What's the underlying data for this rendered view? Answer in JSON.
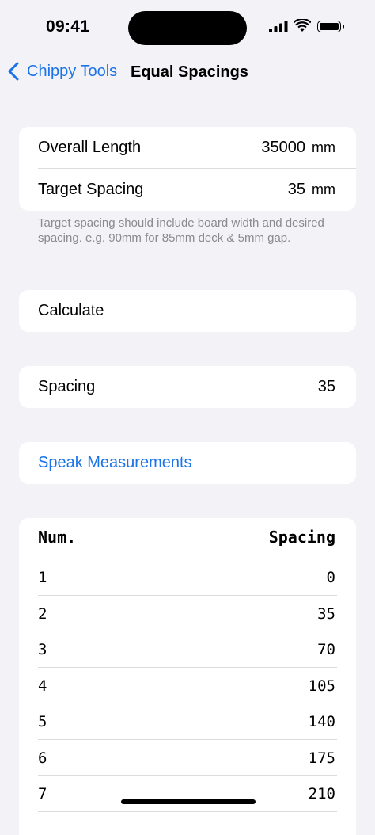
{
  "status_bar": {
    "time": "09:41"
  },
  "nav": {
    "back_label": "Chippy Tools",
    "title": "Equal Spacings"
  },
  "inputs": {
    "overall_length": {
      "label": "Overall Length",
      "value": "35000",
      "unit": "mm"
    },
    "target_spacing": {
      "label": "Target Spacing",
      "value": "35",
      "unit": "mm"
    },
    "hint": "Target spacing should include board width and desired spacing. e.g. 90mm for 85mm deck & 5mm gap."
  },
  "actions": {
    "calculate_label": "Calculate",
    "speak_label": "Speak Measurements"
  },
  "result": {
    "label": "Spacing",
    "value": "35"
  },
  "table": {
    "headers": [
      "Num.",
      "Spacing"
    ],
    "rows": [
      [
        "1",
        "0"
      ],
      [
        "2",
        "35"
      ],
      [
        "3",
        "70"
      ],
      [
        "4",
        "105"
      ],
      [
        "5",
        "140"
      ],
      [
        "6",
        "175"
      ],
      [
        "7",
        "210"
      ]
    ]
  },
  "colors": {
    "accent": "#1a73e8",
    "background": "#f2f2f7",
    "card": "#ffffff",
    "secondary_text": "#8a8a8e"
  },
  "icons": [
    "chevron-left-icon",
    "cellular-signal-icon",
    "wifi-icon",
    "battery-icon"
  ]
}
